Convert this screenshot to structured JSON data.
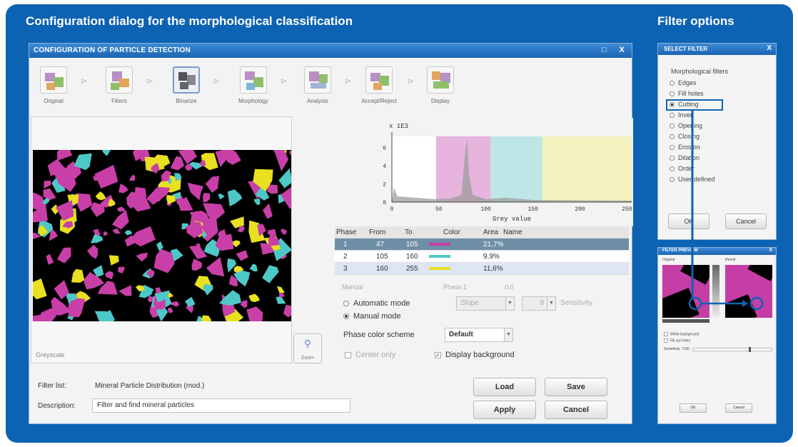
{
  "header": {
    "left_title": "Configuration dialog for the morphological classification",
    "right_title": "Filter options"
  },
  "dialog": {
    "title": "CONFIGURATION OF PARTICLE DETECTION",
    "restore_glyph": "□",
    "close_glyph": "X",
    "steps": [
      {
        "label": "Original",
        "icon": "original-icon"
      },
      {
        "label": "Filters",
        "icon": "filters-icon"
      },
      {
        "label": "Binarize",
        "icon": "binarize-icon"
      },
      {
        "label": "Morphology",
        "icon": "morphology-icon"
      },
      {
        "label": "Analysis",
        "icon": "analysis-icon"
      },
      {
        "label": "Accept/Reject",
        "icon": "accept-reject-icon"
      },
      {
        "label": "Display",
        "icon": "display-icon"
      }
    ],
    "step_arrow": "⊳",
    "image_caption": "Greyscale",
    "zoom_label": "Zoom",
    "histogram": {
      "scale_label": "x 1E3",
      "xlabel": "Grey value",
      "y_ticks": [
        "0",
        "2",
        "4",
        "6"
      ],
      "x_ticks": [
        "0",
        "50",
        "100",
        "150",
        "200",
        "250"
      ],
      "ranges": [
        {
          "from": 0,
          "to": 47,
          "color": "#ffffff"
        },
        {
          "from": 47,
          "to": 105,
          "color": "#e6b4dd"
        },
        {
          "from": 105,
          "to": 160,
          "color": "#bfe6e6"
        },
        {
          "from": 160,
          "to": 255,
          "color": "#f5f2bf"
        }
      ]
    },
    "phase_table": {
      "headers": [
        "Phase",
        "From",
        "To",
        "Color",
        "Area",
        "Name"
      ],
      "rows": [
        {
          "phase": "1",
          "from": "47",
          "to": "105",
          "color": "#c83fa8",
          "area": "21,7%"
        },
        {
          "phase": "2",
          "from": "105",
          "to": "160",
          "color": "#4ec7c7",
          "area": "9,9%"
        },
        {
          "phase": "3",
          "from": "160",
          "to": "255",
          "color": "#e8e020",
          "area": "11,6%"
        }
      ]
    },
    "manual_label": "Manual",
    "phase_info": "Phase 1",
    "phase_value": "0,0",
    "automatic_mode": "Automatic mode",
    "manual_mode": "Manual mode",
    "slope_value": "Slope",
    "sensitivity_value": "9",
    "sensitivity_label": "Sensitivity",
    "phase_color_scheme_label": "Phase color scheme",
    "phase_color_scheme_value": "Default",
    "center_only": "Center only",
    "display_background": "Display background",
    "filter_list_label": "Filter list:",
    "filter_list_value": "Mineral Particle Distribution (mod.)",
    "description_label": "Description:",
    "description_value": "Filter and find mineral particles",
    "load": "Load",
    "save": "Save",
    "apply": "Apply",
    "cancel": "Cancel"
  },
  "select_filter": {
    "title": "SELECT FILTER",
    "close_glyph": "X",
    "heading": "Morphological filters",
    "options": [
      "Edges",
      "Fill holes",
      "Cutting",
      "Invert",
      "Opening",
      "Closing",
      "Erosion",
      "Dilation",
      "Order",
      "User-defined"
    ],
    "selected": "Cutting",
    "ok": "OK",
    "cancel": "Cancel"
  },
  "preview": {
    "title": "FILTER PREVIEW",
    "close_glyph": "X",
    "original_label": "Original",
    "result_label": "Result",
    "white_background": "White background",
    "fill_holes": "Fill out holes",
    "sensitivity_label": "Sensitivity",
    "sensitivity_value": "0.80",
    "ok": "OK",
    "cancel": "Cancel"
  },
  "colors": {
    "brand_blue": "#0d63b3",
    "magenta": "#c83fa8",
    "cyan": "#4ec7c7",
    "yellow": "#e8e020"
  }
}
